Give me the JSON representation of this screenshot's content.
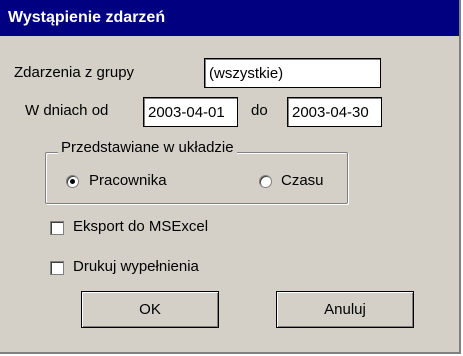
{
  "window": {
    "title": "Wystąpienie zdarzeń"
  },
  "group": {
    "label": "Zdarzenia z grupy",
    "value": "(wszystkie)"
  },
  "dates": {
    "from_label": "W dniach od",
    "from_value": "2003-04-01",
    "to_label": "do",
    "to_value": "2003-04-30"
  },
  "presentation": {
    "legend": "Przedstawiane w układzie",
    "option_employee": "Pracownika",
    "option_time": "Czasu",
    "selected": "Pracownika"
  },
  "options": {
    "export_label": "Eksport do MSExcel",
    "export_checked": false,
    "print_fill_label": "Drukuj wypełnienia",
    "print_fill_checked": false
  },
  "buttons": {
    "ok": "OK",
    "cancel": "Anuluj"
  }
}
